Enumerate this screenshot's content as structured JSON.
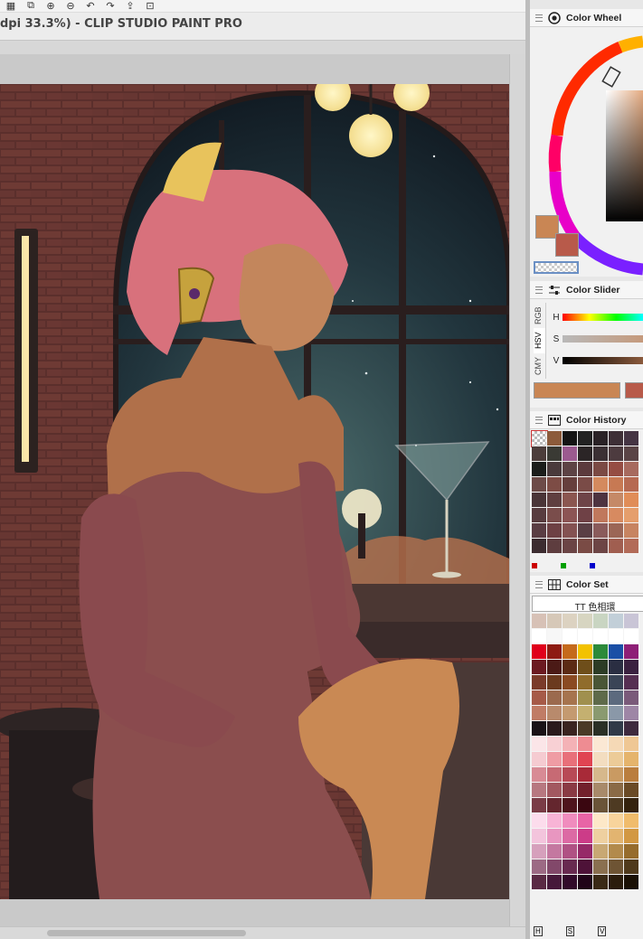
{
  "window": {
    "title": "dpi 33.3%)  - CLIP STUDIO PAINT PRO"
  },
  "toolbar": {
    "icons": [
      "selection-icon",
      "transform-icon",
      "zoom-in-icon",
      "zoom-out-icon",
      "undo-icon",
      "redo-icon",
      "export-icon",
      "import-icon"
    ]
  },
  "color_wheel": {
    "title": "Color Wheel",
    "main_color": "#c98654",
    "sub_color": "#b85a4a"
  },
  "color_slider": {
    "title": "Color Slider",
    "tabs": [
      "RGB",
      "HSV",
      "CMY"
    ],
    "labels": [
      "H",
      "S",
      "V"
    ],
    "h_value": 0.04,
    "s_value": 0.22,
    "v_value": 0.72,
    "preview_color": "#c98654",
    "preview_color2": "#b85a4a"
  },
  "color_history": {
    "title": "Color History",
    "swatches": [
      "transparent",
      "#8c5b3b",
      "#141414",
      "#222222",
      "#2a2226",
      "#3e2f36",
      "#453443",
      "#4c3d3b",
      "#3a3a34",
      "#9b5a8f",
      "#2b2526",
      "#3b3034",
      "#4d3b3f",
      "#5a4446",
      "#1b1d1b",
      "#4a3a3c",
      "#5d4345",
      "#5b3a3d",
      "#7b4a44",
      "#954d43",
      "#a76a5e",
      "#6d4b48",
      "#7d4c45",
      "#663f3c",
      "#7a4b47",
      "#d48a5e",
      "#c77953",
      "#b66a52",
      "#4a3538",
      "#5f3f40",
      "#8b5650",
      "#6e4448",
      "#4e3440",
      "#c58967",
      "#e08d58",
      "#583c3f",
      "#7a4d4b",
      "#8c5454",
      "#6f4146",
      "#c0785c",
      "#d78a60",
      "#e59e6c",
      "#5a3d43",
      "#6e4144",
      "#845252",
      "#5a3f45",
      "#8a5b5b",
      "#9b6656",
      "#c78461",
      "#3c2c30",
      "#5e3d3f",
      "#6b4445",
      "#7a4b45",
      "#6d4545",
      "#a05e50",
      "#b26b58"
    ],
    "channel_marks": [
      "#cc0000",
      "#00a000",
      "#0000cc"
    ]
  },
  "color_set": {
    "title": "Color Set",
    "set_name": "TT 色相環",
    "swatches": [
      "#d7c1b6",
      "#d6c8b8",
      "#dcd2c1",
      "#d7d5c1",
      "#c9d5c2",
      "#c2cfd8",
      "#c9c5d6",
      "#ffffff",
      "#f7f7f7",
      "#ffffff",
      "#ffffff",
      "#ffffff",
      "#ffffff",
      "#ffffff",
      "#e0001b",
      "#8e1b12",
      "#c56a1c",
      "#f2c200",
      "#2c8a3a",
      "#1a4fa6",
      "#8e1f77",
      "#6b1a21",
      "#4b1a16",
      "#5b2a14",
      "#6e4e1a",
      "#2c3c26",
      "#2a2e42",
      "#3a2140",
      "#7a3b2a",
      "#6b3a1e",
      "#8a4a22",
      "#906c2c",
      "#4a5636",
      "#3a4456",
      "#562f52",
      "#a65a48",
      "#9b6a4e",
      "#a6744e",
      "#a0904e",
      "#5e6a4a",
      "#5c6a7e",
      "#7a5a7a",
      "#c07c66",
      "#b88a6c",
      "#c49a70",
      "#c4b070",
      "#8a9a70",
      "#8a98a8",
      "#9e86a6",
      "#1a1216",
      "#2a1a1c",
      "#3a2420",
      "#4a3a26",
      "#2a3026",
      "#303a48",
      "#3e2a3e",
      "#fbe5e8",
      "#f8d0d4",
      "#f4b2b6",
      "#ee8c92",
      "#fbe8d4",
      "#f5d9b6",
      "#efc794",
      "#f5cbd1",
      "#ef9ca4",
      "#e8707a",
      "#e04452",
      "#f3ddc0",
      "#eccb98",
      "#e5b46c",
      "#d88b95",
      "#c76a74",
      "#b84a56",
      "#a82a38",
      "#d6b88c",
      "#c99a62",
      "#ba7e3e",
      "#b77880",
      "#a25860",
      "#8a3a44",
      "#72202c",
      "#a88a6a",
      "#8a6a46",
      "#6a4a26",
      "#7a3c46",
      "#64262e",
      "#4e141c",
      "#3a0610",
      "#6a5438",
      "#4e3a22",
      "#34220e",
      "#fcdcec",
      "#f8b4d6",
      "#f08cbe",
      "#e864a6",
      "#fde8c8",
      "#f8d49c",
      "#f0bc6c",
      "#f3c4dc",
      "#e896c0",
      "#dc6aa4",
      "#cc3c88",
      "#eed0a0",
      "#e2b470",
      "#d29842",
      "#d6a0bc",
      "#c478a0",
      "#b05284",
      "#962a68",
      "#c8a874",
      "#b28a4c",
      "#966c2c",
      "#9c6a84",
      "#82486a",
      "#682a50",
      "#4e1238",
      "#8a7050",
      "#6e5434",
      "#503a1c",
      "#5a2a44",
      "#46183a",
      "#320a2a",
      "#200418",
      "#3a2a16",
      "#2a1c0c",
      "#1a1004"
    ]
  },
  "statusbar": {
    "items": [
      "H",
      "S",
      "V"
    ]
  }
}
